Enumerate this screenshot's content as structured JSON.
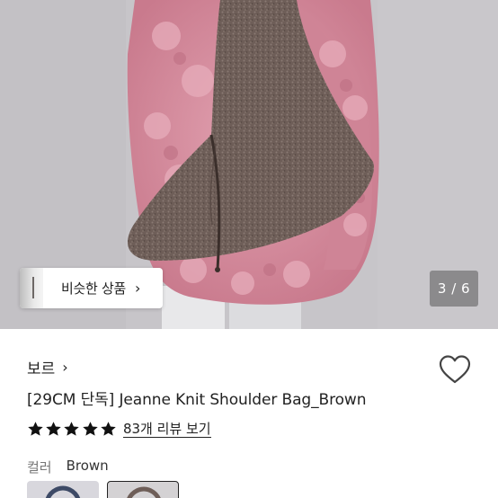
{
  "similar_button": {
    "label": "비슷한 상품",
    "chevron": "›"
  },
  "pager": {
    "text": "3 / 6"
  },
  "brand": {
    "name": "보르",
    "chevron": "›"
  },
  "product": {
    "title": "[29CM 단독] Jeanne Knit Shoulder Bag_Brown"
  },
  "rating": {
    "stars": 5,
    "review_link": "83개 리뷰 보기"
  },
  "option": {
    "label": "컬러",
    "value": "Brown"
  },
  "colors": {
    "background": "#c7c5c9",
    "jacket": "#d7899b",
    "bag": "#6e5e58",
    "star": "#111111"
  },
  "icons": {
    "heart": "heart-outline-icon",
    "star": "star-icon",
    "chevron": "chevron-right-icon"
  }
}
